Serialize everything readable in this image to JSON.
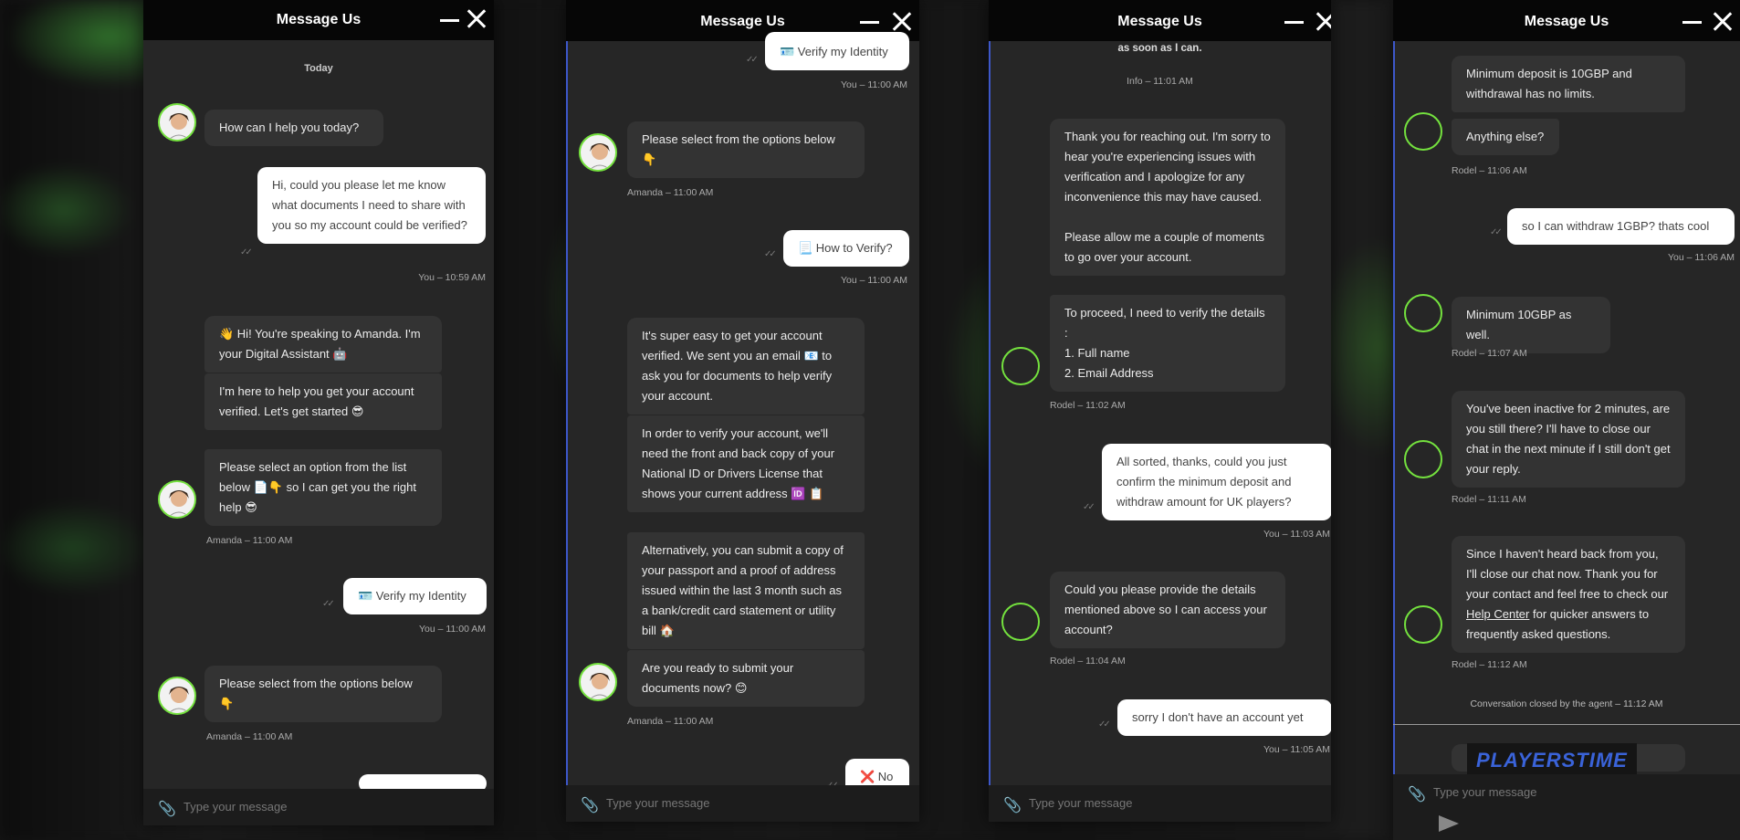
{
  "header_title": "Message Us",
  "input_placeholder": "Type your message",
  "panel1": {
    "date": "Today",
    "msgs": {
      "m1": "How can I help you today?",
      "m2": "Hi, could you please let me know what documents I need to share with you so my account could be verified?",
      "m3": "👋 Hi! You're speaking to Amanda. I'm your Digital Assistant 🤖",
      "m4": "I'm here to help you get your account verified. Let's get started 😎",
      "m5": "Please select an option from the list below 📄👇 so I can get you the right help 😎",
      "m6": "🪪 Verify my Identity",
      "m7": "Please select from the options below 👇"
    },
    "meta": {
      "t1": "You – 10:59 AM",
      "t2": "Amanda – 11:00 AM",
      "t3": "You – 11:00 AM",
      "t4": "Amanda – 11:00 AM"
    }
  },
  "panel2": {
    "msgs": {
      "m1": "🪪 Verify my Identity",
      "m2": "Please select from the options below 👇",
      "m3": "📃 How to Verify?",
      "m4": "It's super easy to get your account verified. We sent you an email 📧 to ask you for documents to help verify your account.",
      "m5": "In order to verify your account, we'll need the front and back copy of your National ID or Drivers License that shows your current address 🆔 📋",
      "m6": "Alternatively, you can submit a copy of your passport and a proof of address issued within the last 3 month such as a bank/credit card statement or utility bill 🏠",
      "m7": "Are you ready to submit your documents now? 😊",
      "m8": "❌ No"
    },
    "meta": {
      "t1": "You – 11:00 AM",
      "t2": "Amanda – 11:00 AM",
      "t3": "You – 11:00 AM",
      "t4": "Amanda – 11:00 AM"
    }
  },
  "panel3": {
    "msgs": {
      "m0": "as soon as I can.",
      "m1": "Thank you for reaching out. I'm sorry to hear you're experiencing issues with verification and I apologize for any inconvenience this may have caused.",
      "m1b": "Please allow me a couple of moments to go over your account.",
      "m2a": "To proceed, I need to verify the details :",
      "m2b": "1. Full name",
      "m2c": "2. Email Address",
      "m3": "All sorted, thanks, could you just confirm the minimum deposit and withdraw amount for UK players?",
      "m4": "Could you please provide the details mentioned above so I can access your account?",
      "m5": "sorry I don't have an account yet"
    },
    "meta": {
      "t0": "Info – 11:01 AM",
      "t1": "Rodel – 11:02 AM",
      "t2": "You – 11:03 AM",
      "t3": "Rodel – 11:04 AM",
      "t4": "You – 11:05 AM"
    }
  },
  "panel4": {
    "msgs": {
      "m1": "Minimum deposit is 10GBP and withdrawal has no limits.",
      "m2": "Anything else?",
      "m3": "so I can withdraw 1GBP? thats cool",
      "m4": "Minimum 10GBP as well.",
      "m5": "You've been inactive for 2 minutes, are you still there? I'll have to close our chat in the next minute if I still don't get your reply.",
      "m6a": "Since I haven't heard back from you, I'll close our chat now. Thank you for your contact and feel free to check our ",
      "m6link": "Help Center",
      "m6b": " for quicker answers to frequently asked questions."
    },
    "meta": {
      "t1": "Rodel – 11:06 AM",
      "t2": "You – 11:06 AM",
      "t3": "Rodel – 11:07 AM",
      "t4": "Rodel – 11:11 AM",
      "t5": "Rodel – 11:12 AM",
      "closed": "Conversation closed by the agent  – 11:12 AM"
    },
    "logo": "PLAYERSTIME"
  }
}
